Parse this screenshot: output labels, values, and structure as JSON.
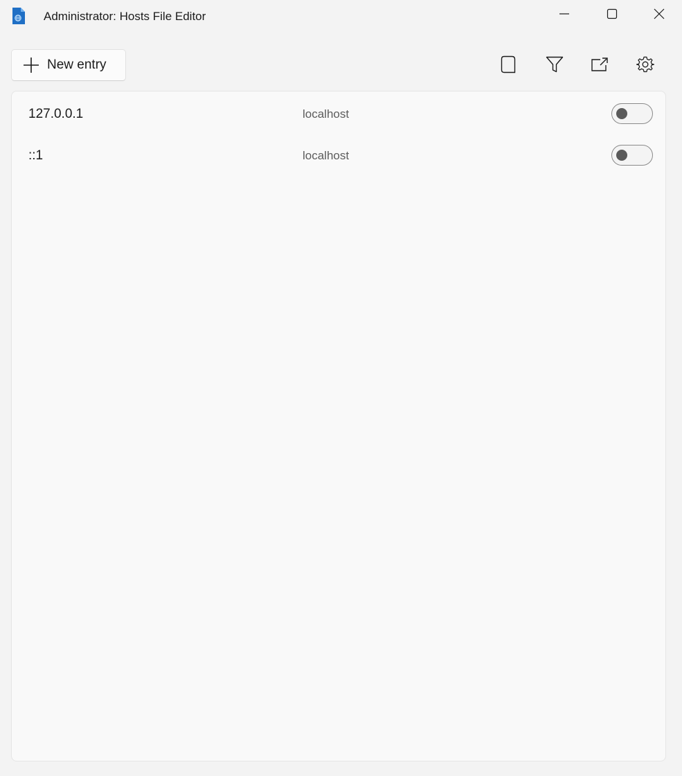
{
  "window": {
    "title": "Administrator: Hosts File Editor",
    "app_icon": "hosts-file-editor-icon",
    "caption_buttons": [
      "minimize-icon",
      "maximize-icon",
      "close-icon"
    ]
  },
  "toolbar": {
    "new_entry_label": "New entry",
    "new_entry_icon": "plus-icon",
    "actions": [
      {
        "name": "additional-lines-button",
        "icon": "document-icon"
      },
      {
        "name": "filter-button",
        "icon": "filter-icon"
      },
      {
        "name": "open-hosts-file-button",
        "icon": "open-external-icon"
      },
      {
        "name": "settings-button",
        "icon": "gear-icon"
      }
    ]
  },
  "entries": [
    {
      "address": "127.0.0.1",
      "hosts": "localhost",
      "active": false
    },
    {
      "address": "::1",
      "hosts": "localhost",
      "active": false
    }
  ],
  "colors": {
    "background": "#f3f3f3",
    "panel": "#f9f9f9",
    "accent": "#1f6fc5"
  }
}
